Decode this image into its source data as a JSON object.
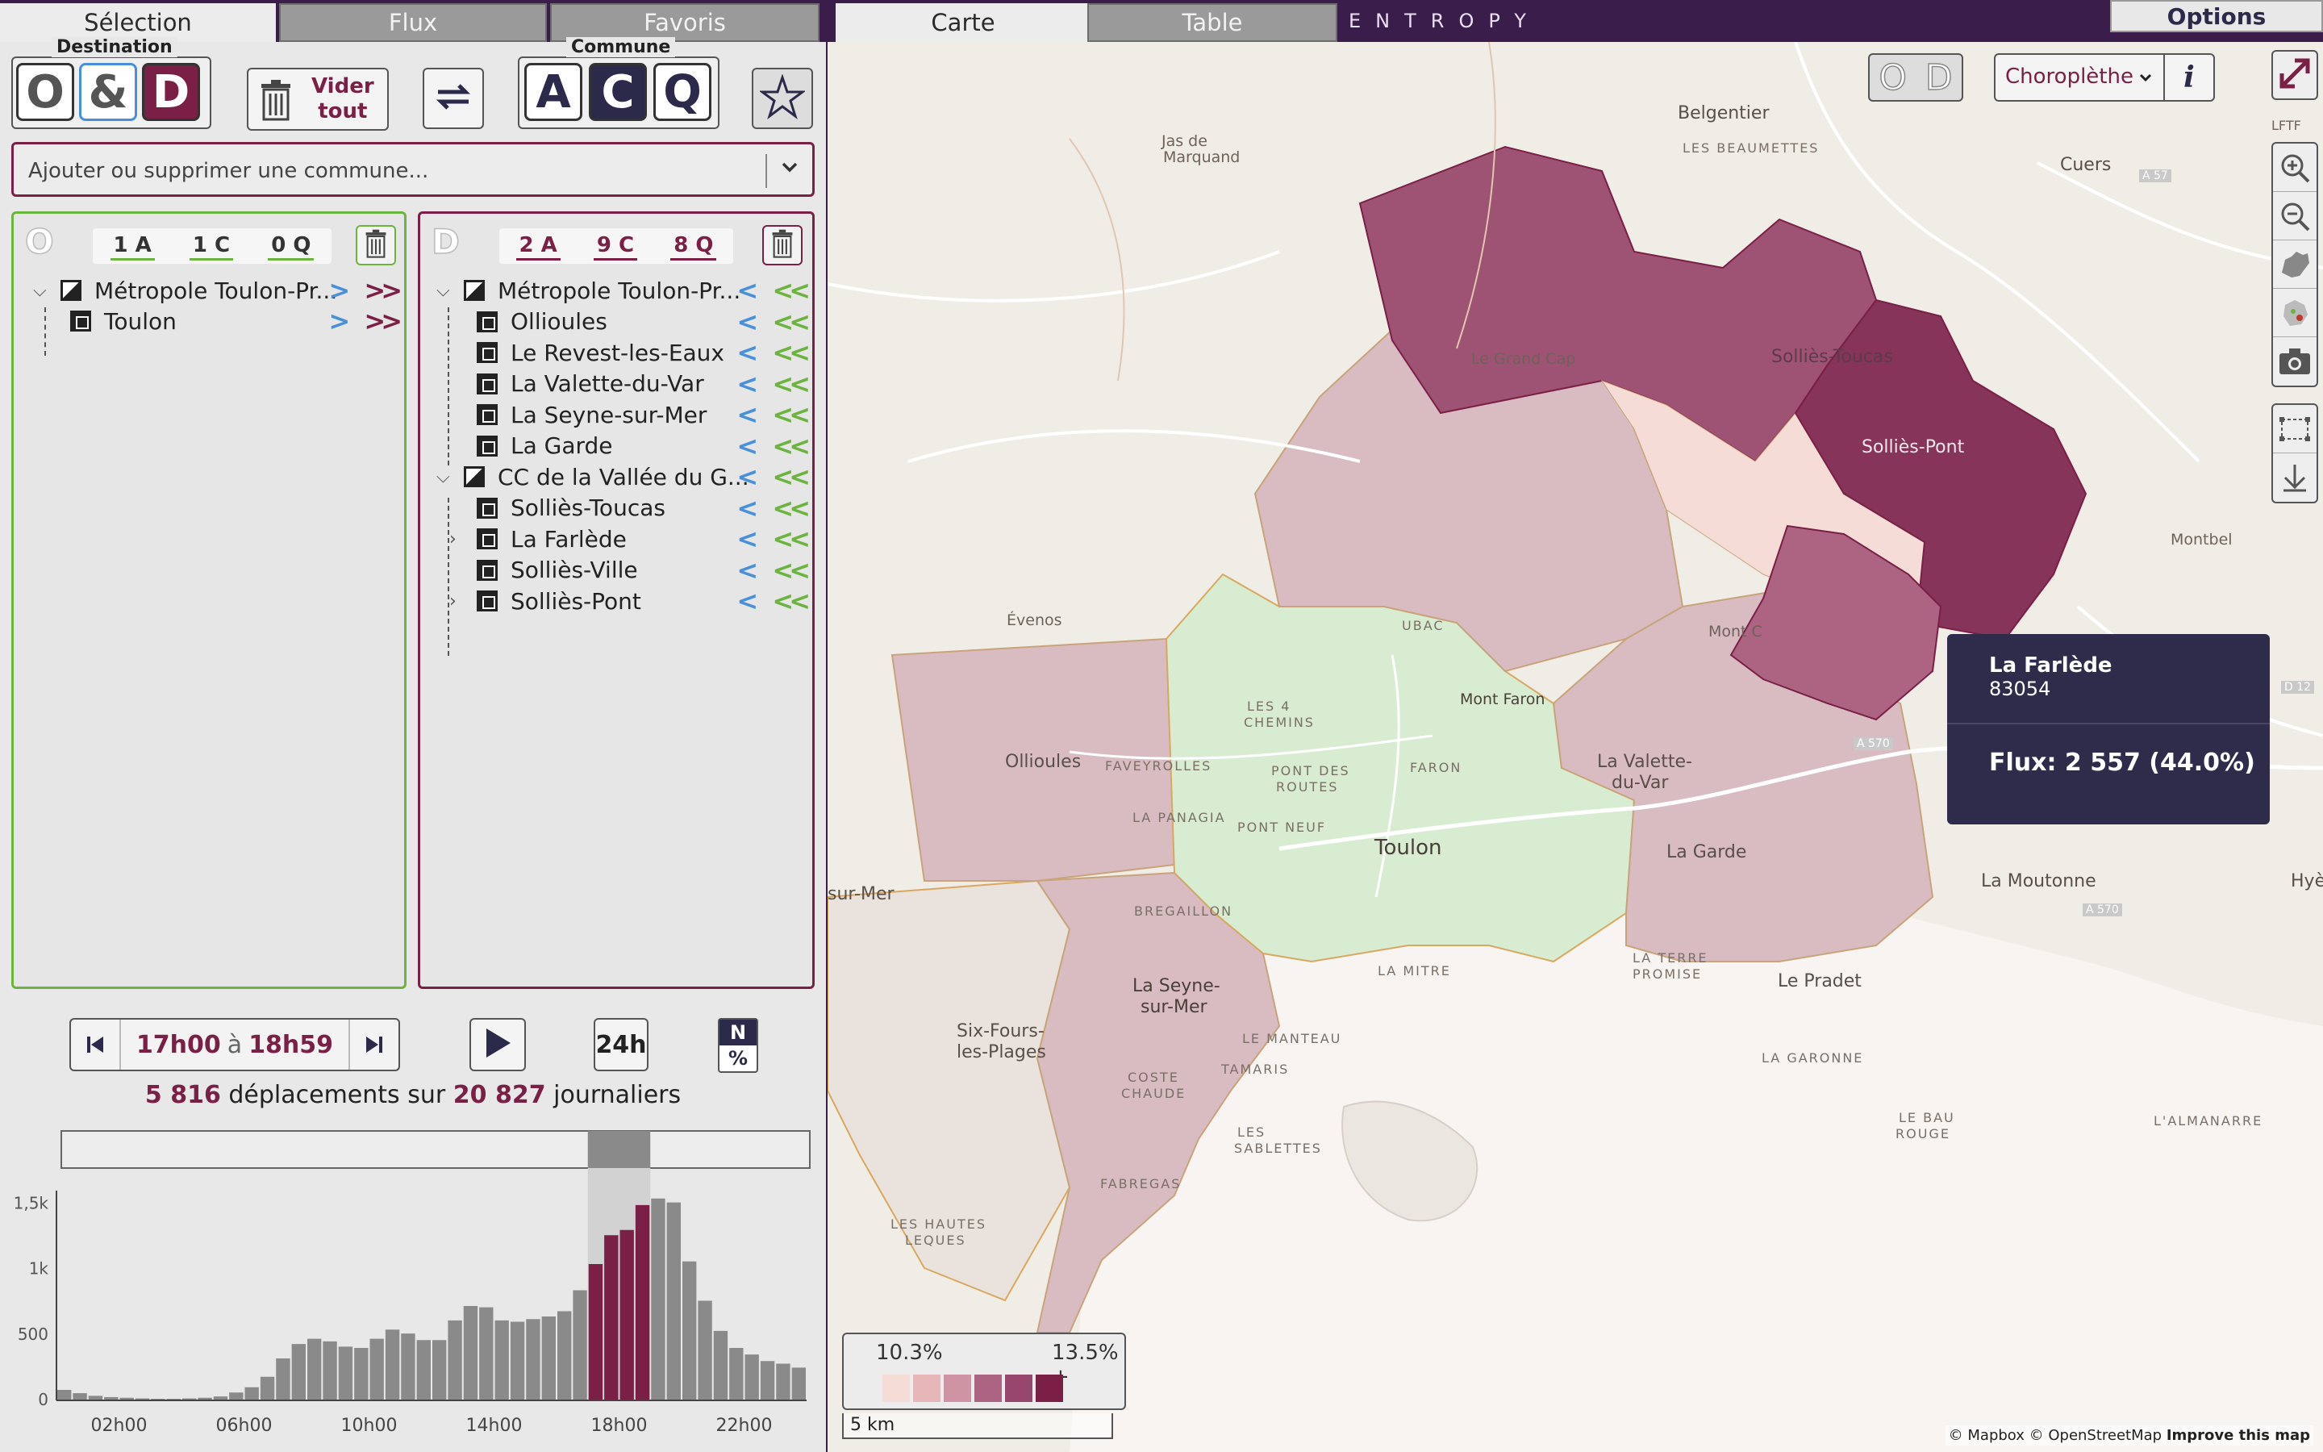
{
  "left_tabs": [
    "Sélection",
    "Flux",
    "Favoris"
  ],
  "right_tabs": [
    "Carte",
    "Table"
  ],
  "brand": "ENTROPY",
  "options_label": "Options",
  "od_group": {
    "label": "Destination",
    "o": "O",
    "amp": "&",
    "d": "D"
  },
  "clear_button": {
    "line1": "Vider",
    "line2": "tout"
  },
  "commune_group": {
    "label": "Commune",
    "a": "A",
    "c": "C",
    "q": "Q"
  },
  "search": {
    "placeholder": "Ajouter ou supprimer une commune..."
  },
  "origin_panel": {
    "letter": "O",
    "counts": [
      "1 A",
      "1 C",
      "0 Q"
    ],
    "items": [
      {
        "label": "Métropole Toulon-Pr...",
        "level": 0
      },
      {
        "label": "Toulon",
        "level": 1
      }
    ]
  },
  "dest_panel": {
    "letter": "D",
    "counts": [
      "2 A",
      "9 C",
      "8 Q"
    ],
    "items": [
      {
        "label": "Métropole Toulon-Pr...",
        "level": 0
      },
      {
        "label": "Ollioules",
        "level": 1
      },
      {
        "label": "Le Revest-les-Eaux",
        "level": 1
      },
      {
        "label": "La Valette-du-Var",
        "level": 1
      },
      {
        "label": "La Seyne-sur-Mer",
        "level": 1
      },
      {
        "label": "La Garde",
        "level": 1
      },
      {
        "label": "CC de la Vallée du G...",
        "level": 0
      },
      {
        "label": "Solliès-Toucas",
        "level": 1
      },
      {
        "label": "La Farlède",
        "level": 1
      },
      {
        "label": "Solliès-Ville",
        "level": 1
      },
      {
        "label": "Solliès-Pont",
        "level": 1
      }
    ]
  },
  "time": {
    "start": "17h00",
    "sep": "à",
    "end": "18h59",
    "period_label": "24h",
    "mode_top": "N",
    "mode_bottom": "%"
  },
  "summary": {
    "count": "5 816",
    "text1": "déplacements sur",
    "total": "20 827",
    "text2": "journaliers"
  },
  "chart_data": {
    "type": "bar",
    "categories": [
      "00h00",
      "00h30",
      "01h00",
      "01h30",
      "02h00",
      "02h30",
      "03h00",
      "03h30",
      "04h00",
      "04h30",
      "05h00",
      "05h30",
      "06h00",
      "06h30",
      "07h00",
      "07h30",
      "08h00",
      "08h30",
      "09h00",
      "09h30",
      "10h00",
      "10h30",
      "11h00",
      "11h30",
      "12h00",
      "12h30",
      "13h00",
      "13h30",
      "14h00",
      "14h30",
      "15h00",
      "15h30",
      "16h00",
      "16h30",
      "17h00",
      "17h30",
      "18h00",
      "18h30",
      "19h00",
      "19h30",
      "20h00",
      "20h30",
      "21h00",
      "21h30",
      "22h00",
      "22h30",
      "23h00",
      "23h30"
    ],
    "values": [
      80,
      55,
      35,
      25,
      20,
      15,
      12,
      12,
      15,
      20,
      30,
      60,
      100,
      180,
      320,
      430,
      470,
      450,
      410,
      400,
      470,
      540,
      510,
      460,
      460,
      610,
      720,
      710,
      610,
      600,
      620,
      640,
      680,
      840,
      1040,
      1260,
      1300,
      1490,
      1540,
      1510,
      1060,
      760,
      530,
      400,
      350,
      300,
      280,
      250
    ],
    "highlight_range": [
      34,
      37
    ],
    "yticks": [
      "0",
      "500",
      "1k",
      "1,5k"
    ],
    "ytick_values": [
      0,
      500,
      1000,
      1500
    ],
    "xticks": [
      "02h00",
      "06h00",
      "10h00",
      "14h00",
      "18h00",
      "22h00"
    ],
    "ylim": [
      0,
      1600
    ],
    "highlight_color": "#7a1f45",
    "bar_color": "#8a8a8a"
  },
  "map": {
    "od_mini": {
      "o": "O",
      "d": "D"
    },
    "mode_label": "Choroplèthe",
    "info_label": "i",
    "tooltip": {
      "name": "La Farlède",
      "code": "83054",
      "flux": "Flux: 2 557 (44.0%)"
    },
    "legend": {
      "min": "10.3%",
      "max": "13.5% +",
      "colors": [
        "#f6dcd6",
        "#e6b6b8",
        "#cf94a3",
        "#ad6483",
        "#97466d",
        "#7a1f45"
      ]
    },
    "scale": "5 km",
    "attribution": {
      "text": "© Mapbox © OpenStreetMap",
      "link": "Improve this map"
    },
    "labels": {
      "belgentier": "Belgentier",
      "beaumettes": "LES BEAUMETTES",
      "cuers": "Cuers",
      "a57": "A 57",
      "jas": "Jas de",
      "marquand": "Marquand",
      "grandcap": "Le Grand Cap",
      "solliestoucas": "Solliès-Toucas",
      "solliespont": "Solliès-Pont",
      "montbel": "Montbel",
      "evenos": "Évenos",
      "ubac": "UBAC",
      "montfaron": "Mont Faron",
      "montc": "Mont C",
      "ollioules": "Ollioules",
      "favey": "FAVEYROLLES",
      "lesquatre": "LES 4",
      "chemins": "CHEMINS",
      "pontdes": "PONT DES",
      "routes": "ROUTES",
      "faron": "FARON",
      "panagia": "LA PANAGIA",
      "pontneuf": "PONT NEUF",
      "toulon": "Toulon",
      "lavalette1": "La Valette-",
      "lavalette2": "du-Var",
      "lagarde": "La Garde",
      "lamoutonne": "La Moutonne",
      "hyeres": "Hyère",
      "a570": "A 570",
      "a570b": "A 570",
      "d12": "D 12",
      "surmer": "sur-Mer",
      "bregaillon": "BREGAILLON",
      "laseyne1": "La Seyne-",
      "laseyne2": "sur-Mer",
      "lamitre": "LA MITRE",
      "laterre": "LA TERRE",
      "promise": "PROMISE",
      "lepradet": "Le Pradet",
      "sixfours1": "Six-Fours-",
      "sixfours2": "les-Plages",
      "lemanteau": "LE MANTEAU",
      "tamaris": "TAMARIS",
      "coste": "COSTE",
      "chaude": "CHAUDE",
      "sablettes1": "LES",
      "sablettes2": "SABLETTES",
      "fabregas": "FABREGAS",
      "hautes1": "LES HAUTES",
      "hautes2": "LEQUES",
      "lagaronne": "LA GARONNE",
      "lebau1": "LE BAU",
      "lebau2": "ROUGE",
      "almanarre": "L'ALMANARRE",
      "lftf": "LFTF"
    }
  }
}
